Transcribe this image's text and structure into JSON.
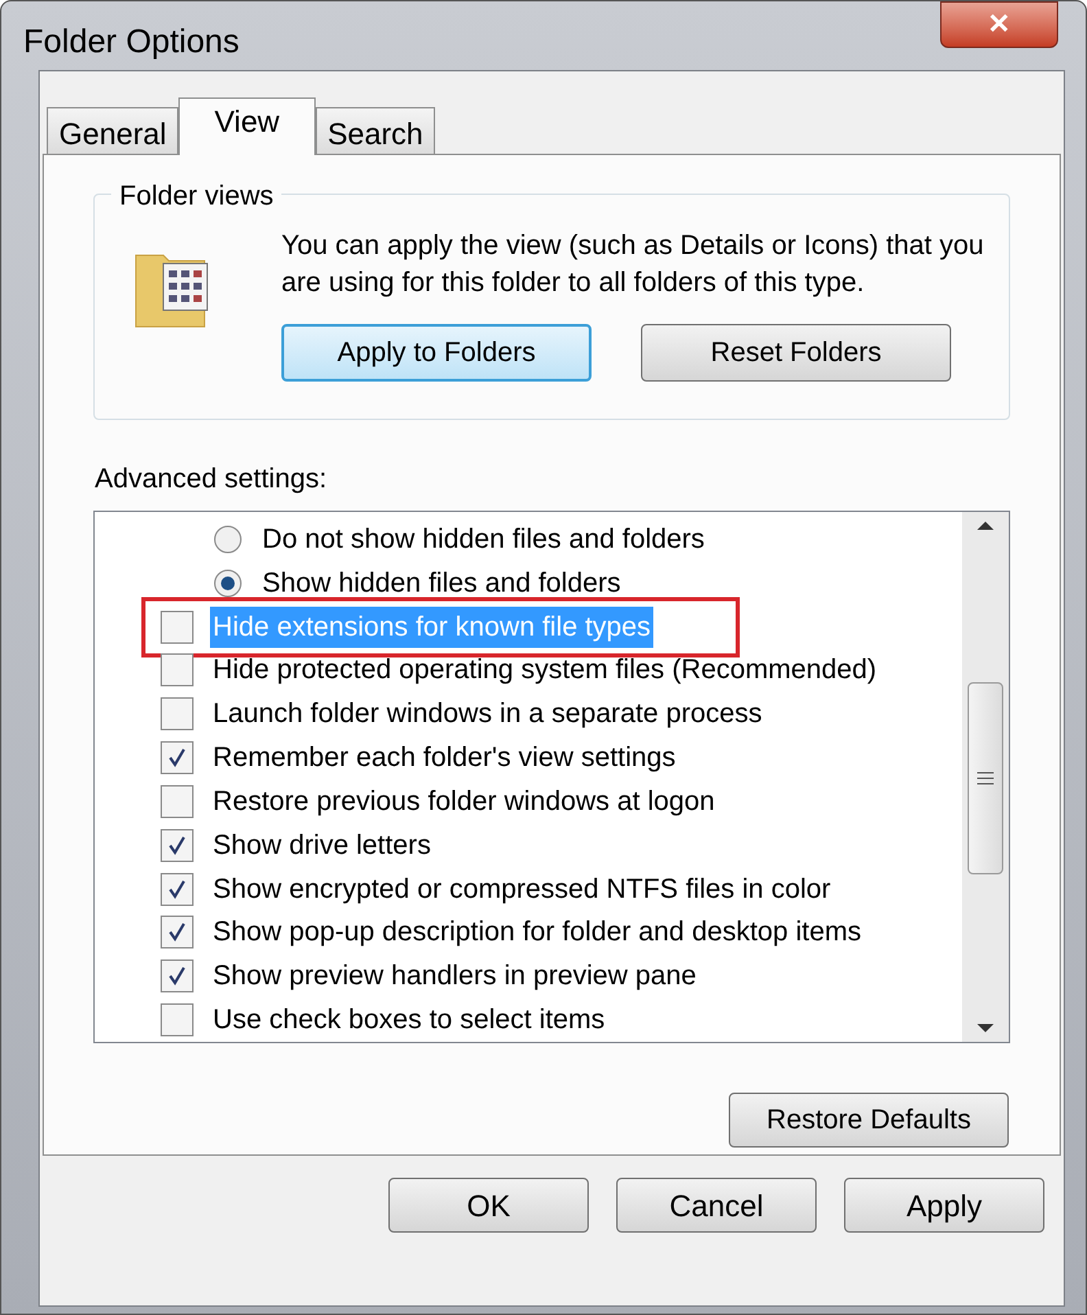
{
  "window": {
    "title": "Folder Options",
    "close": "✕"
  },
  "tabs": [
    {
      "label": "General",
      "selected": false
    },
    {
      "label": "View",
      "selected": true
    },
    {
      "label": "Search",
      "selected": false
    }
  ],
  "folder_views": {
    "title": "Folder views",
    "description": "You can apply the view (such as Details or Icons) that you are using for this folder to all folders of this type.",
    "buttons": [
      {
        "label": "Apply to Folders",
        "focused": true
      },
      {
        "label": "Reset Folders",
        "focused": false
      }
    ]
  },
  "advanced": {
    "title": "Advanced settings:",
    "items": [
      {
        "kind": "radio",
        "label": "Do not show hidden files and folders",
        "checked": false,
        "selected": false,
        "annotated": false
      },
      {
        "kind": "radio",
        "label": "Show hidden files and folders",
        "checked": true,
        "selected": false,
        "annotated": false
      },
      {
        "kind": "checkbox",
        "label": "Hide extensions for known file types",
        "checked": false,
        "selected": true,
        "annotated": true
      },
      {
        "kind": "checkbox",
        "label": "Hide protected operating system files (Recommended)",
        "checked": false,
        "selected": false,
        "annotated": false
      },
      {
        "kind": "checkbox",
        "label": "Launch folder windows in a separate process",
        "checked": false,
        "selected": false,
        "annotated": false
      },
      {
        "kind": "checkbox",
        "label": "Remember each folder's view settings",
        "checked": true,
        "selected": false,
        "annotated": false
      },
      {
        "kind": "checkbox",
        "label": "Restore previous folder windows at logon",
        "checked": false,
        "selected": false,
        "annotated": false
      },
      {
        "kind": "checkbox",
        "label": "Show drive letters",
        "checked": true,
        "selected": false,
        "annotated": false
      },
      {
        "kind": "checkbox",
        "label": "Show encrypted or compressed NTFS files in color",
        "checked": true,
        "selected": false,
        "annotated": false
      },
      {
        "kind": "checkbox",
        "label": "Show pop-up description for folder and desktop items",
        "checked": true,
        "selected": false,
        "annotated": false
      },
      {
        "kind": "checkbox",
        "label": "Show preview handlers in preview pane",
        "checked": true,
        "selected": false,
        "annotated": false
      },
      {
        "kind": "checkbox",
        "label": "Use check boxes to select items",
        "checked": false,
        "selected": false,
        "annotated": false
      }
    ],
    "restore_button": "Restore Defaults"
  },
  "buttons": [
    "OK",
    "Cancel",
    "Apply"
  ]
}
